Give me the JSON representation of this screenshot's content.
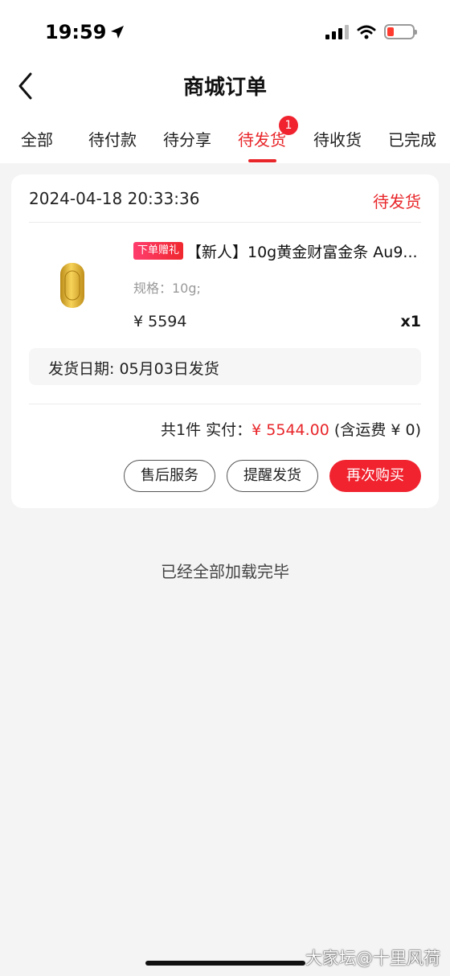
{
  "status_bar": {
    "time": "19:59",
    "battery_color": "#ff3b30"
  },
  "nav": {
    "title": "商城订单",
    "back_icon": "chevron-left-icon"
  },
  "tabs": [
    {
      "label": "全部",
      "active": false
    },
    {
      "label": "待付款",
      "active": false
    },
    {
      "label": "待分享",
      "active": false
    },
    {
      "label": "待发货",
      "active": true,
      "badge": "1"
    },
    {
      "label": "待收货",
      "active": false
    },
    {
      "label": "已完成",
      "active": false
    }
  ],
  "order": {
    "datetime": "2024-04-18 20:33:36",
    "status": "待发货",
    "product": {
      "promo_tag": "下单赠礼",
      "name": "【新人】10g黄金财富金条 Au9...",
      "spec": "规格：10g;",
      "price": "¥ 5594",
      "quantity": "x1"
    },
    "shipping": "发货日期: 05月03日发货",
    "total": {
      "count_label": "共1件 实付：",
      "amount": "¥ 5544.00",
      "shipping_fee": "(含运费 ¥ 0)"
    },
    "buttons": {
      "after_sales": "售后服务",
      "remind_ship": "提醒发货",
      "buy_again": "再次购买"
    }
  },
  "footer": {
    "load_done": "已经全部加载完毕"
  },
  "watermark": "大家坛@十里风荷",
  "colors": {
    "accent": "#e8262a",
    "background": "#f4f4f4"
  }
}
